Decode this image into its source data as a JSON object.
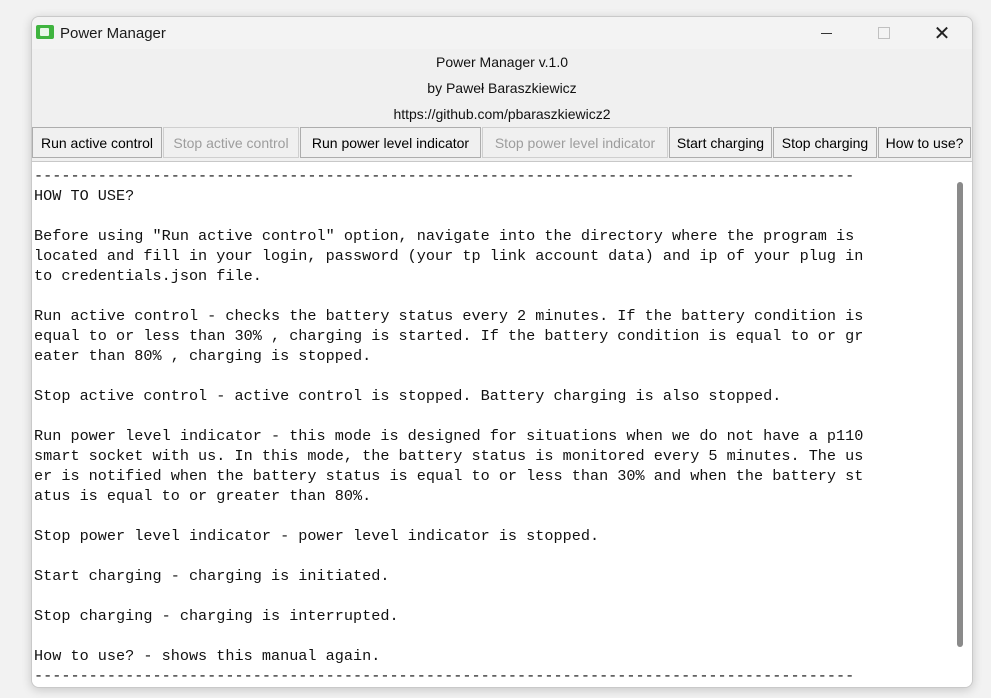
{
  "window": {
    "title": "Power Manager",
    "minimize": "—",
    "maximize": "☐",
    "close": "✕"
  },
  "header": {
    "line1": "Power Manager v.1.0",
    "line2": "by Paweł Baraszkiewicz",
    "line3": "https://github.com/pbaraszkiewicz2"
  },
  "toolbar": {
    "buttons": [
      {
        "label": "Run active control",
        "enabled": true
      },
      {
        "label": "Stop active control",
        "enabled": false
      },
      {
        "label": "Run power level indicator",
        "enabled": true
      },
      {
        "label": "Stop power level indicator",
        "enabled": false
      },
      {
        "label": "Start charging",
        "enabled": true
      },
      {
        "label": "Stop charging",
        "enabled": true
      },
      {
        "label": "How to use?",
        "enabled": true
      }
    ]
  },
  "manual": {
    "lines": [
      "------------------------------------------------------------------------------------------",
      "HOW TO USE?",
      "",
      "Before using \"Run active control\" option, navigate into the directory where the program is",
      "located and fill in your login, password (your tp link account data) and ip of your plug in",
      "to credentials.json file.",
      "",
      "Run active control - checks the battery status every 2 minutes. If the battery condition is",
      "equal to or less than 30% , charging is started. If the battery condition is equal to or gr",
      "eater than 80% , charging is stopped.",
      "",
      "Stop active control - active control is stopped. Battery charging is also stopped.",
      "",
      "Run power level indicator - this mode is designed for situations when we do not have a p110",
      "smart socket with us. In this mode, the battery status is monitored every 5 minutes. The us",
      "er is notified when the battery status is equal to or less than 30% and when the battery st",
      "atus is equal to or greater than 80%.",
      "",
      "Stop power level indicator - power level indicator is stopped.",
      "",
      "Start charging - charging is initiated.",
      "",
      "Stop charging - charging is interrupted.",
      "",
      "How to use? - shows this manual again.",
      "------------------------------------------------------------------------------------------"
    ]
  }
}
